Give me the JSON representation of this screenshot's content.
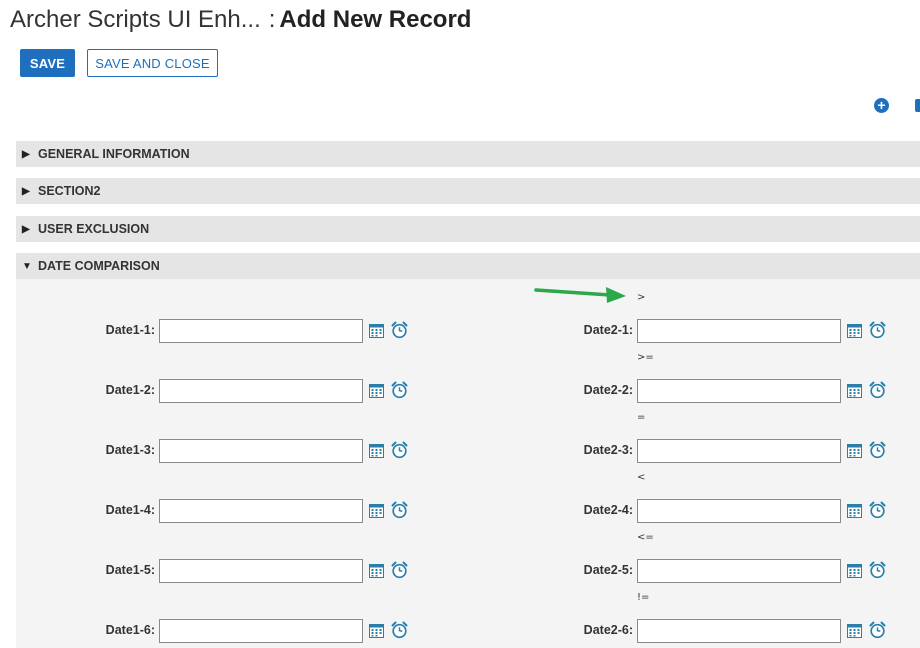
{
  "header": {
    "app_name": "Archer Scripts UI Enh...",
    "separator": ":",
    "record_title": "Add New Record"
  },
  "toolbar": {
    "save_label": "SAVE",
    "save_close_label": "SAVE AND CLOSE"
  },
  "sections": [
    {
      "label": "GENERAL INFORMATION",
      "arrow": "▶",
      "expanded": false
    },
    {
      "label": "SECTION2",
      "arrow": "▶",
      "expanded": false
    },
    {
      "label": "USER EXCLUSION",
      "arrow": "▶",
      "expanded": false
    },
    {
      "label": "DATE COMPARISON",
      "arrow": "▼",
      "expanded": true
    }
  ],
  "operators": [
    ">",
    ">=",
    "=",
    "<",
    "<=",
    "!="
  ],
  "date_rows": [
    {
      "left_label": "Date1-1:",
      "right_label": "Date2-1:",
      "left_value": "",
      "right_value": ""
    },
    {
      "left_label": "Date1-2:",
      "right_label": "Date2-2:",
      "left_value": "",
      "right_value": ""
    },
    {
      "left_label": "Date1-3:",
      "right_label": "Date2-3:",
      "left_value": "",
      "right_value": ""
    },
    {
      "left_label": "Date1-4:",
      "right_label": "Date2-4:",
      "left_value": "",
      "right_value": ""
    },
    {
      "left_label": "Date1-5:",
      "right_label": "Date2-5:",
      "left_value": "",
      "right_value": ""
    },
    {
      "left_label": "Date1-6:",
      "right_label": "Date2-6:",
      "left_value": "",
      "right_value": ""
    }
  ],
  "icons": {
    "add": "plus-circle-icon",
    "calendar": "calendar-icon",
    "clock": "alarm-clock-icon",
    "annotation": "green-arrow-icon"
  },
  "colors": {
    "accent": "#1f6fbf",
    "section_bg": "#e5e5e5",
    "panel_bg": "#f4f4f4",
    "annotation": "#2ba84a",
    "icon_teal": "#2a7fa8"
  }
}
